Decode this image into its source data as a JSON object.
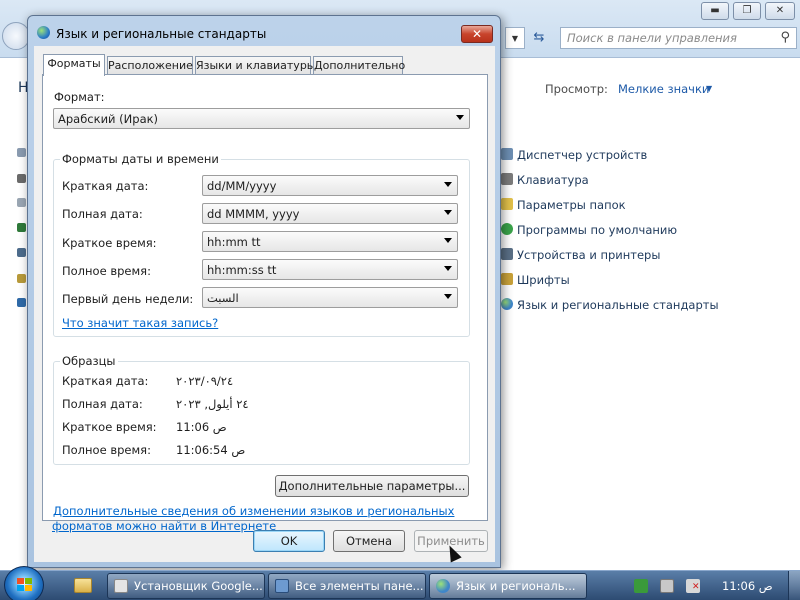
{
  "control_panel": {
    "caption_buttons": {
      "minimize": "▬",
      "maximize": "❐",
      "close": "✕"
    },
    "search_placeholder": "Поиск в панели управления",
    "partial_letter": "Н",
    "view_label": "Просмотр:",
    "view_value": "Мелкие значки",
    "items": [
      {
        "label": "Диспетчер устройств",
        "icon": "device-manager-icon",
        "color": "#6d8fb3"
      },
      {
        "label": "Клавиатура",
        "icon": "keyboard-icon",
        "color": "#7c7c7c"
      },
      {
        "label": "Параметры папок",
        "icon": "folder-options-icon",
        "color": "#e2c14a"
      },
      {
        "label": "Программы по умолчанию",
        "icon": "default-programs-icon",
        "color": "#3aa34a"
      },
      {
        "label": "Устройства и принтеры",
        "icon": "printer-icon",
        "color": "#5a6f86"
      },
      {
        "label": "Шрифты",
        "icon": "fonts-icon",
        "color": "#c9a23a"
      },
      {
        "label": "Язык и региональные стандарты",
        "icon": "globe-icon",
        "color": "#3f86c9"
      }
    ]
  },
  "dialog": {
    "title": "Язык и региональные стандарты",
    "close_label": "✕",
    "tabs": [
      {
        "label": "Форматы",
        "active": true
      },
      {
        "label": "Расположение",
        "active": false
      },
      {
        "label": "Языки и клавиатуры",
        "active": false
      },
      {
        "label": "Дополнительно",
        "active": false
      }
    ],
    "format_label": "Формат:",
    "format_value": "Арабский (Ирак)",
    "datetime_group_title": "Форматы даты и времени",
    "datetime_rows": [
      {
        "label": "Краткая дата:",
        "value": "dd/MM/yyyy"
      },
      {
        "label": "Полная дата:",
        "value": "dd MMMM, yyyy"
      },
      {
        "label": "Краткое время:",
        "value": "hh:mm tt"
      },
      {
        "label": "Полное время:",
        "value": "hh:mm:ss tt"
      },
      {
        "label": "Первый день недели:",
        "value": "السبت"
      }
    ],
    "help_link": "Что значит такая запись?",
    "samples_group_title": "Образцы",
    "samples": [
      {
        "label": "Краткая дата:",
        "value": "٢٠٢٣/٠٩/٢٤"
      },
      {
        "label": "Полная дата:",
        "value": "٢٤ أيلول, ٢٠٢٣"
      },
      {
        "label": "Краткое время:",
        "value": "11:06 ص"
      },
      {
        "label": "Полное время:",
        "value": "11:06:54 ص"
      }
    ],
    "additional_settings_button": "Дополнительные параметры...",
    "info_link_line1": "Дополнительные сведения об изменении языков и региональных",
    "info_link_line2": "форматов можно найти в Интернете",
    "ok_button": "OK",
    "cancel_button": "Отмена",
    "apply_button": "Применить"
  },
  "taskbar": {
    "tasks": [
      {
        "label": "Установщик Google...",
        "icon": "installer-icon",
        "active": false
      },
      {
        "label": "Все элементы пане...",
        "icon": "control-panel-icon",
        "active": false
      },
      {
        "label": "Язык и региональ...",
        "icon": "globe-icon",
        "active": true
      }
    ],
    "clock": "11:06 ص"
  },
  "colors": {
    "accent_link": "#0066cc",
    "taskbar_top": "#5a7ea8",
    "taskbar_bottom": "#2d4b72",
    "close_red": "#c8442c"
  }
}
